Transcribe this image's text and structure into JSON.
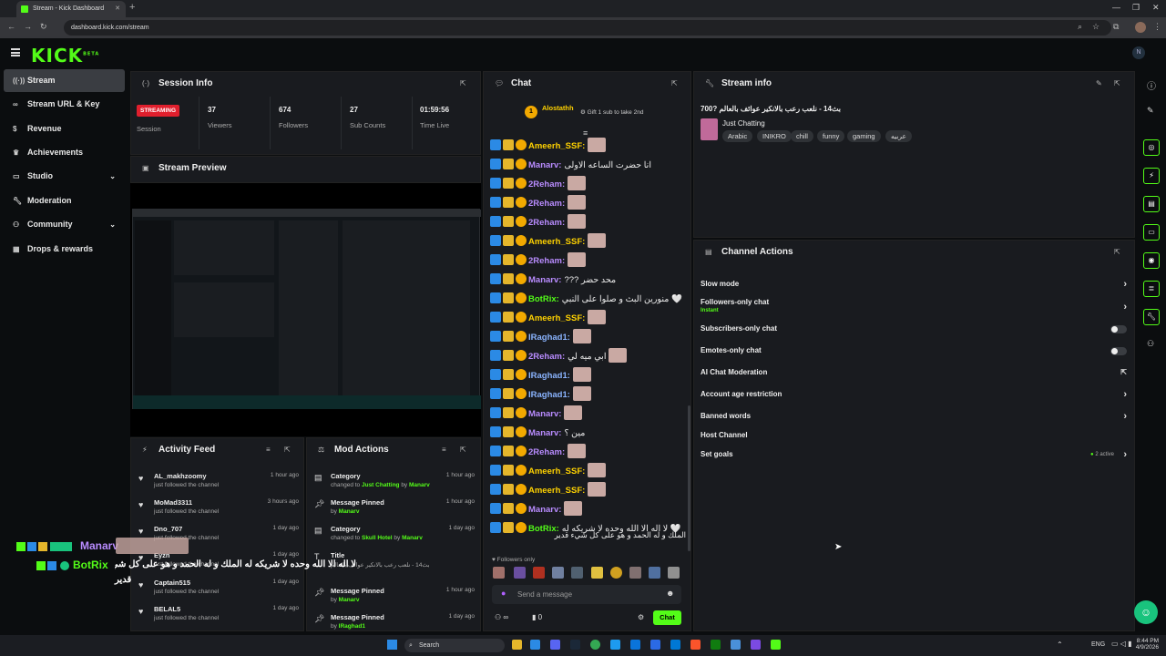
{
  "browser": {
    "tab_title": "Stream - Kick Dashboard",
    "url": "dashboard.kick.com/stream"
  },
  "app": {
    "logo": "KICK",
    "logo_sup": "BETA"
  },
  "sidebar": {
    "items": [
      {
        "label": "Stream",
        "icon": "broadcast-icon",
        "active": true
      },
      {
        "label": "Stream URL & Key",
        "icon": "link-icon"
      },
      {
        "label": "Revenue",
        "icon": "dollar-icon"
      },
      {
        "label": "Achievements",
        "icon": "trophy-icon"
      },
      {
        "label": "Studio",
        "icon": "studio-icon",
        "chevron": true
      },
      {
        "label": "Moderation",
        "icon": "wrench-icon"
      },
      {
        "label": "Community",
        "icon": "people-icon",
        "chevron": true
      },
      {
        "label": "Drops & rewards",
        "icon": "gift-icon"
      }
    ]
  },
  "session": {
    "title": "Session Info",
    "status": "STREAMING",
    "status_label": "Session",
    "stats": [
      {
        "value": "37",
        "label": "Viewers"
      },
      {
        "value": "674",
        "label": "Followers"
      },
      {
        "value": "27",
        "label": "Sub Counts"
      },
      {
        "value": "01:59:56",
        "label": "Time Live"
      }
    ]
  },
  "preview": {
    "title": "Stream Preview"
  },
  "activity": {
    "title": "Activity Feed",
    "rows": [
      {
        "name": "AL_makhzoomy",
        "sub": "just followed the channel",
        "time": "1 hour ago"
      },
      {
        "name": "MoMad3311",
        "sub": "just followed the channel",
        "time": "3 hours ago"
      },
      {
        "name": "Dno_707",
        "sub": "just followed the channel",
        "time": "1 day ago"
      },
      {
        "name": "Eyzn",
        "sub": "just followed the channel",
        "time": "1 day ago"
      },
      {
        "name": "Captain515",
        "sub": "just followed the channel",
        "time": "1 day ago"
      },
      {
        "name": "BELAL5",
        "sub": "just followed the channel",
        "time": "1 day ago"
      }
    ]
  },
  "mod_actions": {
    "title": "Mod Actions",
    "rows": [
      {
        "name": "Category",
        "sub_pre": "changed to ",
        "sub_val": "Just Chatting",
        "sub_by": " by ",
        "sub_user": "Manarv",
        "time": "1 hour ago",
        "icon": "category-icon"
      },
      {
        "name": "Message Pinned",
        "sub_pre": "by ",
        "sub_val": "",
        "sub_by": "",
        "sub_user": "Manarv",
        "time": "1 hour ago",
        "icon": "pin-icon"
      },
      {
        "name": "Category",
        "sub_pre": "changed to ",
        "sub_val": "Skull Hotel",
        "sub_by": " by ",
        "sub_user": "Manarv",
        "time": "1 day ago",
        "icon": "category-icon"
      },
      {
        "name": "Title",
        "sub_pre": "بث14 - نلعب رعب بالانكير عوائف بالعالم ",
        "sub_val": "",
        "sub_by": "",
        "sub_user": "",
        "time": "",
        "icon": "title-icon"
      },
      {
        "name": "Message Pinned",
        "sub_pre": "by ",
        "sub_val": "",
        "sub_by": "",
        "sub_user": "Manarv",
        "time": "1 hour ago",
        "icon": "pin-icon"
      },
      {
        "name": "Message Pinned",
        "sub_pre": "by ",
        "sub_val": "",
        "sub_by": "",
        "sub_user": "IRaghad1",
        "time": "1 day ago",
        "icon": "pin-icon"
      }
    ]
  },
  "chat": {
    "title": "Chat",
    "top_user": "Alostathh",
    "top_sub": "1",
    "gift_text": "Gift 1 sub to take 2nd",
    "lines": [
      {
        "user": "Ameerh_SSF:",
        "color": "#ffd200",
        "msg": "",
        "emote": true
      },
      {
        "user": "Manarv:",
        "color": "#b98cff",
        "msg": "انا حضرت الساعه الاولى",
        "emote": false
      },
      {
        "user": "2Reham:",
        "color": "#b98cff",
        "msg": "",
        "emote": true
      },
      {
        "user": "2Reham:",
        "color": "#b98cff",
        "msg": "",
        "emote": true
      },
      {
        "user": "2Reham:",
        "color": "#b98cff",
        "msg": "",
        "emote": true
      },
      {
        "user": "Ameerh_SSF:",
        "color": "#ffd200",
        "msg": "",
        "emote": true
      },
      {
        "user": "2Reham:",
        "color": "#b98cff",
        "msg": "",
        "emote": true
      },
      {
        "user": "Manarv:",
        "color": "#b98cff",
        "msg": "??? محد حضر",
        "emote": false
      },
      {
        "user": "BotRix:",
        "color": "#53fc18",
        "msg": "منورين البث و صلوا على النبي 🤍",
        "emote": false
      },
      {
        "user": "Ameerh_SSF:",
        "color": "#ffd200",
        "msg": "",
        "emote": true
      },
      {
        "user": "IRaghad1:",
        "color": "#8ab4ff",
        "msg": "",
        "emote": true
      },
      {
        "user": "2Reham:",
        "color": "#b98cff",
        "msg": "ابي ميه لي",
        "emote": true
      },
      {
        "user": "IRaghad1:",
        "color": "#8ab4ff",
        "msg": "",
        "emote": true
      },
      {
        "user": "IRaghad1:",
        "color": "#8ab4ff",
        "msg": "",
        "emote": true
      },
      {
        "user": "Manarv:",
        "color": "#b98cff",
        "msg": "",
        "emote": true
      },
      {
        "user": "Manarv:",
        "color": "#b98cff",
        "msg": "مين ؟",
        "emote": false
      },
      {
        "user": "2Reham:",
        "color": "#b98cff",
        "msg": "",
        "emote": true
      },
      {
        "user": "Ameerh_SSF:",
        "color": "#ffd200",
        "msg": "",
        "emote": true
      },
      {
        "user": "Ameerh_SSF:",
        "color": "#ffd200",
        "msg": "",
        "emote": true
      },
      {
        "user": "Manarv:",
        "color": "#b98cff",
        "msg": "",
        "emote": true
      },
      {
        "user": "BotRix:",
        "color": "#53fc18",
        "msg": "لا اله الا الله وحده لا شريكه له 🤍",
        "emote": false
      }
    ],
    "last_line2": "الملك و له الحمد و هو على كل شيء قدير",
    "followers_only": "Followers only",
    "input_placeholder": "Send a message",
    "count": "0",
    "send_label": "Chat"
  },
  "stream_info": {
    "title": "Stream info",
    "stream_title": "بث14 - نلعب رعب بالانكير عوائف بالعالم ?700",
    "category": "Just Chatting",
    "tags": [
      "Arabic",
      "INIKRO",
      "chill",
      "funny",
      "gaming",
      "عربيه"
    ]
  },
  "channel_actions": {
    "title": "Channel Actions",
    "rows": [
      {
        "label": "Slow mode",
        "type": "chevron"
      },
      {
        "label": "Followers-only chat",
        "sub": "Instant",
        "type": "chevron"
      },
      {
        "label": "Subscribers-only chat",
        "type": "toggle"
      },
      {
        "label": "Emotes-only chat",
        "type": "toggle"
      },
      {
        "label": "AI Chat Moderation",
        "type": "external"
      },
      {
        "label": "Account age restriction",
        "type": "chevron"
      },
      {
        "label": "Banned words",
        "type": "chevron"
      },
      {
        "label": "Host Channel",
        "type": "none"
      },
      {
        "label": "Set goals",
        "type": "chevron",
        "badge": "2 active"
      }
    ]
  },
  "overlay": {
    "user1": "Manarv",
    "user2": "BotRix",
    "botrix_msg": "لا اله الا الله وحده لا شريكه له الملك و له الحمد و هو على كل شيء",
    "botrix_msg2": "قدير",
    "viewer_count": "37"
  },
  "taskbar": {
    "search": "Search",
    "lang": "ENG",
    "time": "8:44 PM",
    "date": "4/9/2026"
  }
}
